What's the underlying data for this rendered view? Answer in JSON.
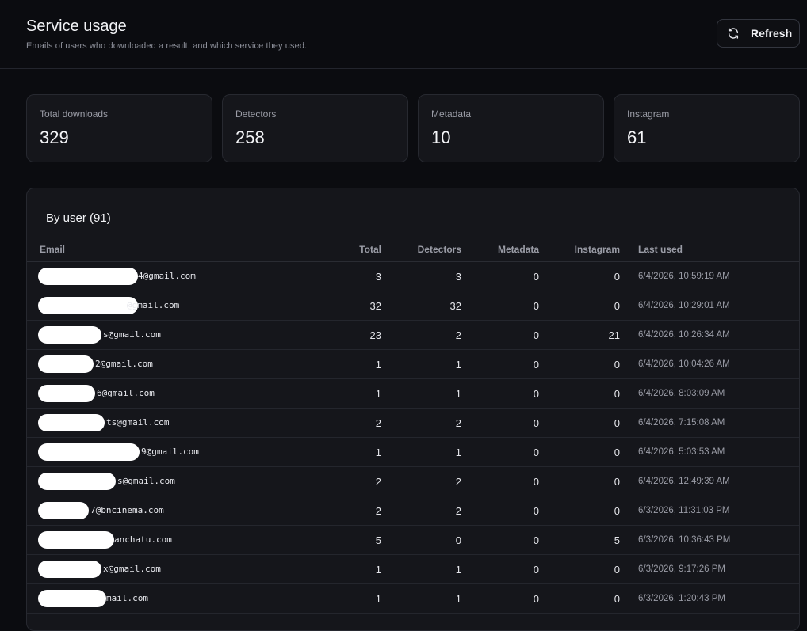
{
  "header": {
    "title": "Service usage",
    "subtitle": "Emails of users who downloaded a result, and which service they used.",
    "refresh_label": "Refresh"
  },
  "stats": [
    {
      "label": "Total downloads",
      "value": "329"
    },
    {
      "label": "Detectors",
      "value": "258"
    },
    {
      "label": "Metadata",
      "value": "10"
    },
    {
      "label": "Instagram",
      "value": "61"
    }
  ],
  "table": {
    "title": "By user (91)",
    "columns": [
      "Email",
      "Total",
      "Detectors",
      "Metadata",
      "Instagram",
      "Last used"
    ],
    "rows": [
      {
        "email": "4@gmail.com",
        "total": "3",
        "detectors": "3",
        "metadata": "0",
        "instagram": "0",
        "last_used": "6/4/2026, 10:59:19 AM"
      },
      {
        "email": "@gmail.com",
        "total": "32",
        "detectors": "32",
        "metadata": "0",
        "instagram": "0",
        "last_used": "6/4/2026, 10:29:01 AM"
      },
      {
        "email": "s@gmail.com",
        "total": "23",
        "detectors": "2",
        "metadata": "0",
        "instagram": "21",
        "last_used": "6/4/2026, 10:26:34 AM"
      },
      {
        "email": "2@gmail.com",
        "total": "1",
        "detectors": "1",
        "metadata": "0",
        "instagram": "0",
        "last_used": "6/4/2026, 10:04:26 AM"
      },
      {
        "email": "6@gmail.com",
        "total": "1",
        "detectors": "1",
        "metadata": "0",
        "instagram": "0",
        "last_used": "6/4/2026, 8:03:09 AM"
      },
      {
        "email": "ts@gmail.com",
        "total": "2",
        "detectors": "2",
        "metadata": "0",
        "instagram": "0",
        "last_used": "6/4/2026, 7:15:08 AM"
      },
      {
        "email": "9@gmail.com",
        "total": "1",
        "detectors": "1",
        "metadata": "0",
        "instagram": "0",
        "last_used": "6/4/2026, 5:03:53 AM"
      },
      {
        "email": "s@gmail.com",
        "total": "2",
        "detectors": "2",
        "metadata": "0",
        "instagram": "0",
        "last_used": "6/4/2026, 12:49:39 AM"
      },
      {
        "email": "7@bncinema.com",
        "total": "2",
        "detectors": "2",
        "metadata": "0",
        "instagram": "0",
        "last_used": "6/3/2026, 11:31:03 PM"
      },
      {
        "email": "anchatu.com",
        "total": "5",
        "detectors": "0",
        "metadata": "0",
        "instagram": "5",
        "last_used": "6/3/2026, 10:36:43 PM"
      },
      {
        "email": "x@gmail.com",
        "total": "1",
        "detectors": "1",
        "metadata": "0",
        "instagram": "0",
        "last_used": "6/3/2026, 9:17:26 PM"
      },
      {
        "email": "mail.com",
        "total": "1",
        "detectors": "1",
        "metadata": "0",
        "instagram": "0",
        "last_used": "6/3/2026, 1:20:43 PM"
      }
    ]
  },
  "icons": {
    "refresh": "refresh-icon"
  },
  "colors": {
    "background": "#0b0c10",
    "card": "#15161b",
    "border": "#272930",
    "muted_text": "#9a9ca6"
  }
}
